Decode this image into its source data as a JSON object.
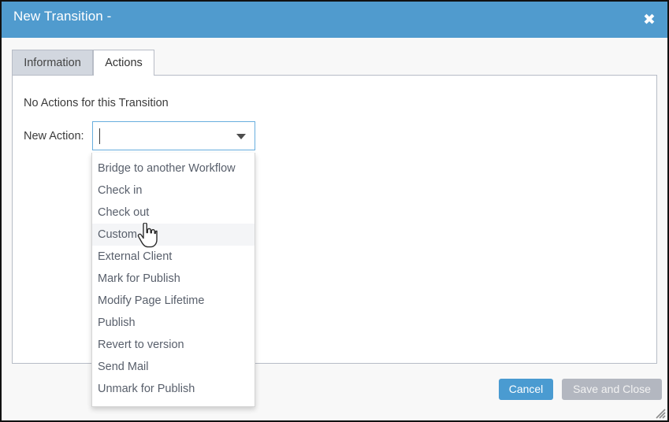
{
  "window": {
    "title": "New Transition -",
    "close_icon": "close-icon",
    "resize_grip_icon": "resize-grip-icon"
  },
  "tabs": [
    {
      "label": "Information",
      "active": false
    },
    {
      "label": "Actions",
      "active": true
    }
  ],
  "content": {
    "status_text": "No Actions for this Transition",
    "new_action_label": "New Action:",
    "combobox": {
      "value": "",
      "placeholder": "",
      "arrow_icon": "chevron-down-icon",
      "focused": true,
      "expanded": true
    }
  },
  "dropdown": {
    "highlighted_index": 3,
    "options": [
      "Bridge to another Workflow",
      "Check in",
      "Check out",
      "Custom",
      "External Client",
      "Mark for Publish",
      "Modify Page Lifetime",
      "Publish",
      "Revert to version",
      "Send Mail",
      "Unmark for Publish"
    ]
  },
  "footer": {
    "cancel_label": "Cancel",
    "save_and_close_label": "Save and Close",
    "save_and_close_disabled": true
  },
  "cursor": {
    "type": "pointer-hand-cursor"
  },
  "colors": {
    "titlebar": "#509bce",
    "accent_button": "#4a9bd1",
    "disabled_button": "#b3b7c0",
    "tab_inactive": "#d2d7df",
    "panel_border": "#b7bcc6",
    "focus_border": "#68aede",
    "highlight_row": "#f4f5f7"
  }
}
